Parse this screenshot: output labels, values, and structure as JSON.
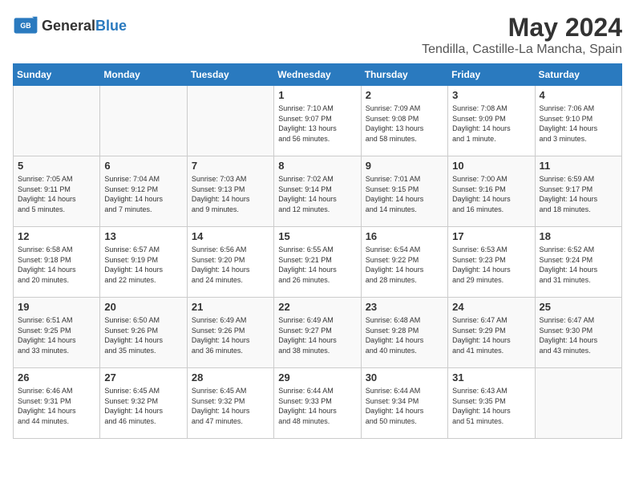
{
  "header": {
    "logo_general": "General",
    "logo_blue": "Blue",
    "month": "May 2024",
    "location": "Tendilla, Castille-La Mancha, Spain"
  },
  "weekdays": [
    "Sunday",
    "Monday",
    "Tuesday",
    "Wednesday",
    "Thursday",
    "Friday",
    "Saturday"
  ],
  "weeks": [
    [
      {
        "day": "",
        "info": ""
      },
      {
        "day": "",
        "info": ""
      },
      {
        "day": "",
        "info": ""
      },
      {
        "day": "1",
        "info": "Sunrise: 7:10 AM\nSunset: 9:07 PM\nDaylight: 13 hours\nand 56 minutes."
      },
      {
        "day": "2",
        "info": "Sunrise: 7:09 AM\nSunset: 9:08 PM\nDaylight: 13 hours\nand 58 minutes."
      },
      {
        "day": "3",
        "info": "Sunrise: 7:08 AM\nSunset: 9:09 PM\nDaylight: 14 hours\nand 1 minute."
      },
      {
        "day": "4",
        "info": "Sunrise: 7:06 AM\nSunset: 9:10 PM\nDaylight: 14 hours\nand 3 minutes."
      }
    ],
    [
      {
        "day": "5",
        "info": "Sunrise: 7:05 AM\nSunset: 9:11 PM\nDaylight: 14 hours\nand 5 minutes."
      },
      {
        "day": "6",
        "info": "Sunrise: 7:04 AM\nSunset: 9:12 PM\nDaylight: 14 hours\nand 7 minutes."
      },
      {
        "day": "7",
        "info": "Sunrise: 7:03 AM\nSunset: 9:13 PM\nDaylight: 14 hours\nand 9 minutes."
      },
      {
        "day": "8",
        "info": "Sunrise: 7:02 AM\nSunset: 9:14 PM\nDaylight: 14 hours\nand 12 minutes."
      },
      {
        "day": "9",
        "info": "Sunrise: 7:01 AM\nSunset: 9:15 PM\nDaylight: 14 hours\nand 14 minutes."
      },
      {
        "day": "10",
        "info": "Sunrise: 7:00 AM\nSunset: 9:16 PM\nDaylight: 14 hours\nand 16 minutes."
      },
      {
        "day": "11",
        "info": "Sunrise: 6:59 AM\nSunset: 9:17 PM\nDaylight: 14 hours\nand 18 minutes."
      }
    ],
    [
      {
        "day": "12",
        "info": "Sunrise: 6:58 AM\nSunset: 9:18 PM\nDaylight: 14 hours\nand 20 minutes."
      },
      {
        "day": "13",
        "info": "Sunrise: 6:57 AM\nSunset: 9:19 PM\nDaylight: 14 hours\nand 22 minutes."
      },
      {
        "day": "14",
        "info": "Sunrise: 6:56 AM\nSunset: 9:20 PM\nDaylight: 14 hours\nand 24 minutes."
      },
      {
        "day": "15",
        "info": "Sunrise: 6:55 AM\nSunset: 9:21 PM\nDaylight: 14 hours\nand 26 minutes."
      },
      {
        "day": "16",
        "info": "Sunrise: 6:54 AM\nSunset: 9:22 PM\nDaylight: 14 hours\nand 28 minutes."
      },
      {
        "day": "17",
        "info": "Sunrise: 6:53 AM\nSunset: 9:23 PM\nDaylight: 14 hours\nand 29 minutes."
      },
      {
        "day": "18",
        "info": "Sunrise: 6:52 AM\nSunset: 9:24 PM\nDaylight: 14 hours\nand 31 minutes."
      }
    ],
    [
      {
        "day": "19",
        "info": "Sunrise: 6:51 AM\nSunset: 9:25 PM\nDaylight: 14 hours\nand 33 minutes."
      },
      {
        "day": "20",
        "info": "Sunrise: 6:50 AM\nSunset: 9:26 PM\nDaylight: 14 hours\nand 35 minutes."
      },
      {
        "day": "21",
        "info": "Sunrise: 6:49 AM\nSunset: 9:26 PM\nDaylight: 14 hours\nand 36 minutes."
      },
      {
        "day": "22",
        "info": "Sunrise: 6:49 AM\nSunset: 9:27 PM\nDaylight: 14 hours\nand 38 minutes."
      },
      {
        "day": "23",
        "info": "Sunrise: 6:48 AM\nSunset: 9:28 PM\nDaylight: 14 hours\nand 40 minutes."
      },
      {
        "day": "24",
        "info": "Sunrise: 6:47 AM\nSunset: 9:29 PM\nDaylight: 14 hours\nand 41 minutes."
      },
      {
        "day": "25",
        "info": "Sunrise: 6:47 AM\nSunset: 9:30 PM\nDaylight: 14 hours\nand 43 minutes."
      }
    ],
    [
      {
        "day": "26",
        "info": "Sunrise: 6:46 AM\nSunset: 9:31 PM\nDaylight: 14 hours\nand 44 minutes."
      },
      {
        "day": "27",
        "info": "Sunrise: 6:45 AM\nSunset: 9:32 PM\nDaylight: 14 hours\nand 46 minutes."
      },
      {
        "day": "28",
        "info": "Sunrise: 6:45 AM\nSunset: 9:32 PM\nDaylight: 14 hours\nand 47 minutes."
      },
      {
        "day": "29",
        "info": "Sunrise: 6:44 AM\nSunset: 9:33 PM\nDaylight: 14 hours\nand 48 minutes."
      },
      {
        "day": "30",
        "info": "Sunrise: 6:44 AM\nSunset: 9:34 PM\nDaylight: 14 hours\nand 50 minutes."
      },
      {
        "day": "31",
        "info": "Sunrise: 6:43 AM\nSunset: 9:35 PM\nDaylight: 14 hours\nand 51 minutes."
      },
      {
        "day": "",
        "info": ""
      }
    ]
  ]
}
